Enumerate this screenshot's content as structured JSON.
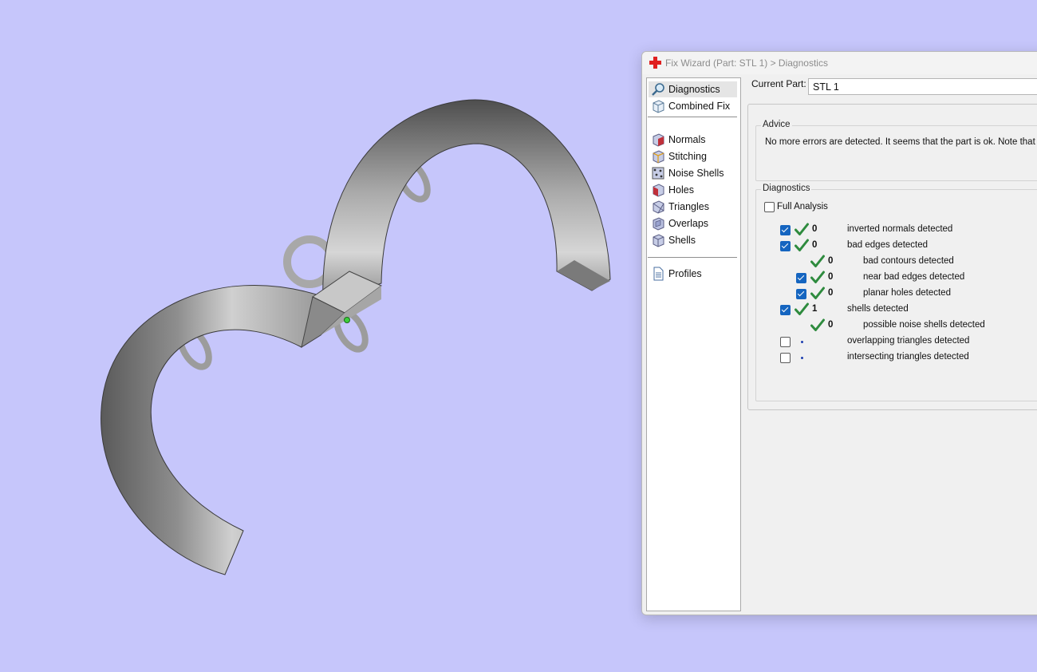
{
  "window": {
    "title": "Fix Wizard (Part: STL 1) > Diagnostics",
    "app_icon": "red-cross-icon"
  },
  "nav": {
    "items": [
      {
        "label": "Diagnostics",
        "icon": "magnifier-icon",
        "selected": true
      },
      {
        "label": "Combined Fix",
        "icon": "cube-icon"
      },
      {
        "label": "Normals",
        "icon": "normals-cube-icon"
      },
      {
        "label": "Stitching",
        "icon": "stitching-cube-icon"
      },
      {
        "label": "Noise Shells",
        "icon": "noise-shells-icon"
      },
      {
        "label": "Holes",
        "icon": "holes-cube-icon"
      },
      {
        "label": "Triangles",
        "icon": "triangles-cube-icon"
      },
      {
        "label": "Overlaps",
        "icon": "overlaps-cube-icon"
      },
      {
        "label": "Shells",
        "icon": "shells-cube-icon"
      },
      {
        "label": "Profiles",
        "icon": "document-icon"
      }
    ]
  },
  "current_part": {
    "label": "Current Part:",
    "value": "STL 1"
  },
  "advice": {
    "title": "Advice",
    "text": "No more errors are detected. It seems that the part is ok. Note that no"
  },
  "diagnostics": {
    "title": "Diagnostics",
    "full_analysis_label": "Full Analysis",
    "full_analysis_checked": false,
    "rows": [
      {
        "checkbox": true,
        "checked": true,
        "status": "ok",
        "count": "0",
        "label": "inverted normals detected",
        "indent": 0
      },
      {
        "checkbox": true,
        "checked": true,
        "status": "ok",
        "count": "0",
        "label": "bad edges detected",
        "indent": 0
      },
      {
        "checkbox": false,
        "checked": false,
        "status": "ok",
        "count": "0",
        "label": "bad contours detected",
        "indent": 1
      },
      {
        "checkbox": true,
        "checked": true,
        "status": "ok",
        "count": "0",
        "label": "near bad edges detected",
        "indent": 1
      },
      {
        "checkbox": true,
        "checked": true,
        "status": "ok",
        "count": "0",
        "label": "planar holes detected",
        "indent": 1
      },
      {
        "checkbox": true,
        "checked": true,
        "status": "ok",
        "count": "1",
        "label": "shells detected",
        "indent": 0
      },
      {
        "checkbox": false,
        "checked": false,
        "status": "ok",
        "count": "0",
        "label": "possible noise shells detected",
        "indent": 1
      },
      {
        "checkbox": true,
        "checked": false,
        "status": "pending",
        "count": "",
        "label": "overlapping triangles detected",
        "indent": 0
      },
      {
        "checkbox": true,
        "checked": false,
        "status": "pending",
        "count": "",
        "label": "intersecting triangles detected",
        "indent": 0
      }
    ]
  },
  "colors": {
    "viewport_bg": "#c6c6fb",
    "check_green": "#2e8b3e",
    "checkbox_blue": "#1565c0"
  }
}
